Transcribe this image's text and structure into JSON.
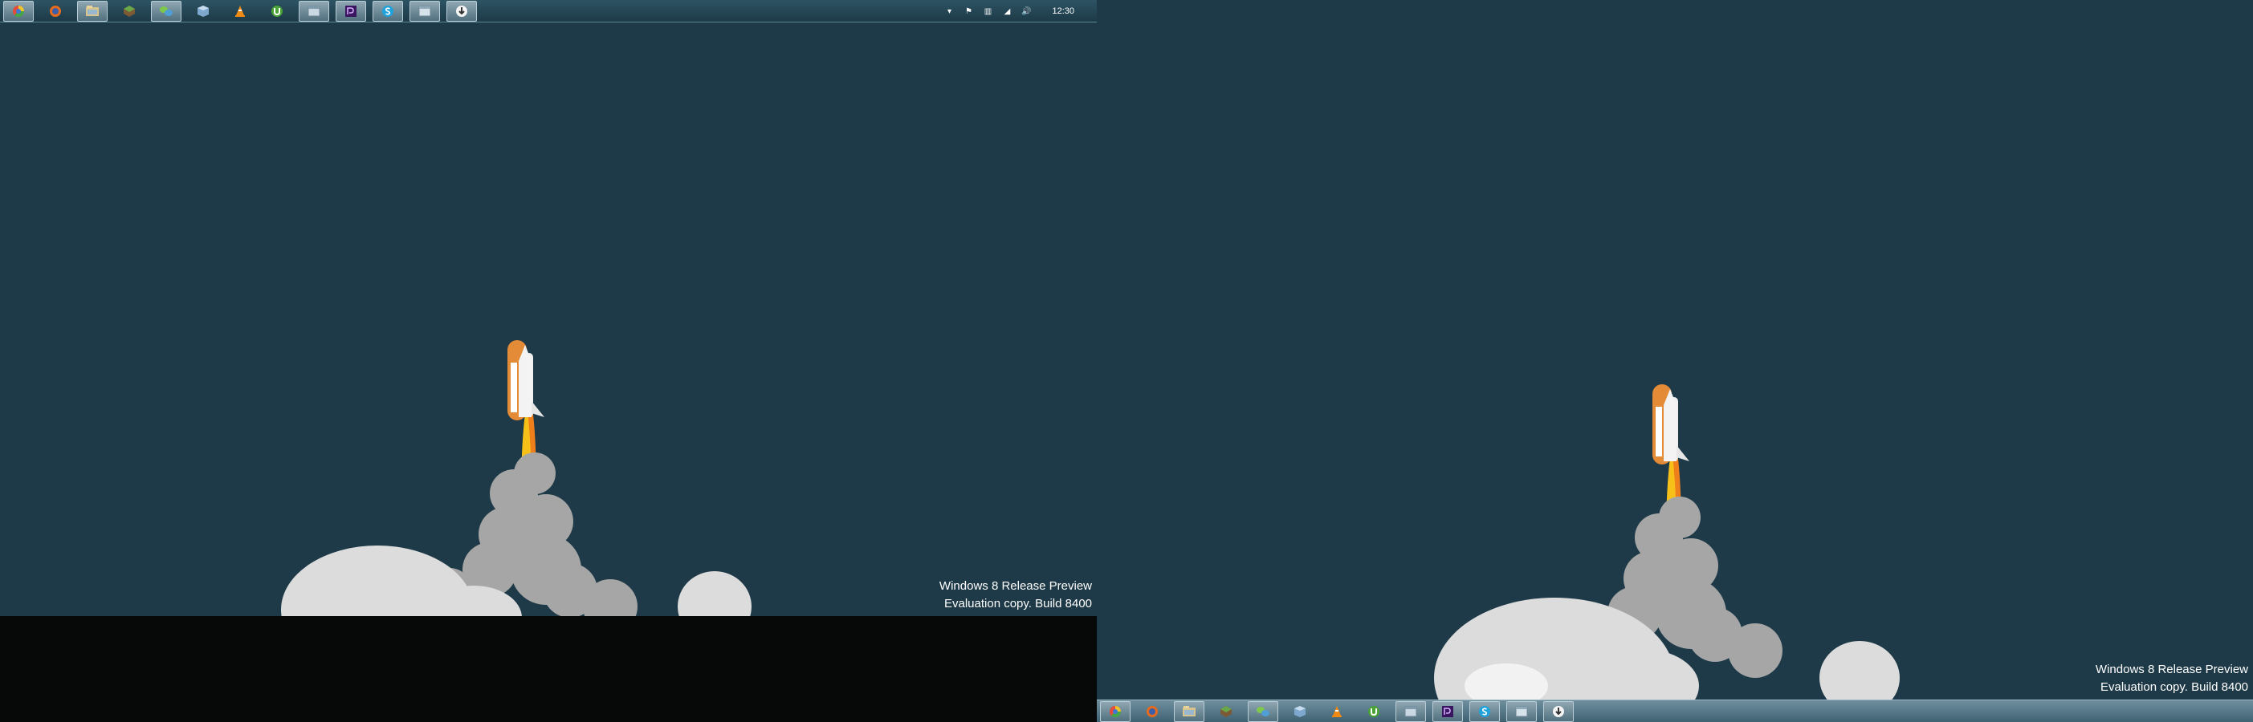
{
  "left_screen": {
    "taskbar": {
      "apps": [
        {
          "name": "chrome-icon",
          "active": true
        },
        {
          "name": "firefox-icon",
          "active": false
        },
        {
          "name": "file-explorer-icon",
          "active": true
        },
        {
          "name": "minecraft-icon",
          "active": false
        },
        {
          "name": "windows-live-messenger-icon",
          "active": true
        },
        {
          "name": "virtualbox-icon",
          "active": false
        },
        {
          "name": "vlc-icon",
          "active": false
        },
        {
          "name": "utorrent-icon",
          "active": false
        },
        {
          "name": "window-icon",
          "active": true
        },
        {
          "name": "premiere-icon",
          "active": true
        },
        {
          "name": "skype-icon",
          "active": true
        },
        {
          "name": "window-icon",
          "active": true
        },
        {
          "name": "download-icon",
          "active": true
        }
      ],
      "tray": {
        "icons": [
          "chevron-up-icon",
          "flag-icon",
          "network-adapter-icon",
          "signal-icon",
          "volume-icon"
        ],
        "time": "12:30"
      }
    },
    "watermark": {
      "line1": "Windows 8 Release Preview",
      "line2": "Evaluation copy. Build 8400"
    }
  },
  "right_screen": {
    "taskbar": {
      "apps": [
        {
          "name": "chrome-icon",
          "active": true
        },
        {
          "name": "firefox-icon",
          "active": false
        },
        {
          "name": "file-explorer-icon",
          "active": true
        },
        {
          "name": "minecraft-icon",
          "active": false
        },
        {
          "name": "windows-live-messenger-icon",
          "active": true
        },
        {
          "name": "virtualbox-icon",
          "active": false
        },
        {
          "name": "vlc-icon",
          "active": false
        },
        {
          "name": "utorrent-icon",
          "active": false
        },
        {
          "name": "window-icon",
          "active": true
        },
        {
          "name": "premiere-icon",
          "active": true
        },
        {
          "name": "skype-icon",
          "active": true
        },
        {
          "name": "window-icon",
          "active": true
        },
        {
          "name": "download-icon",
          "active": true
        }
      ]
    },
    "watermark": {
      "line1": "Windows 8 Release Preview",
      "line2": "Evaluation copy. Build 8400"
    }
  },
  "colors": {
    "wallpaper": "#1e3a48",
    "top_taskbar": "#24495a",
    "bottom_taskbar": "#5f7f8f",
    "smoke": "#a6a6a6",
    "cloud": "#d8d8d8",
    "rocket_booster": "#e98e3b",
    "flame": "#f5c21b"
  }
}
